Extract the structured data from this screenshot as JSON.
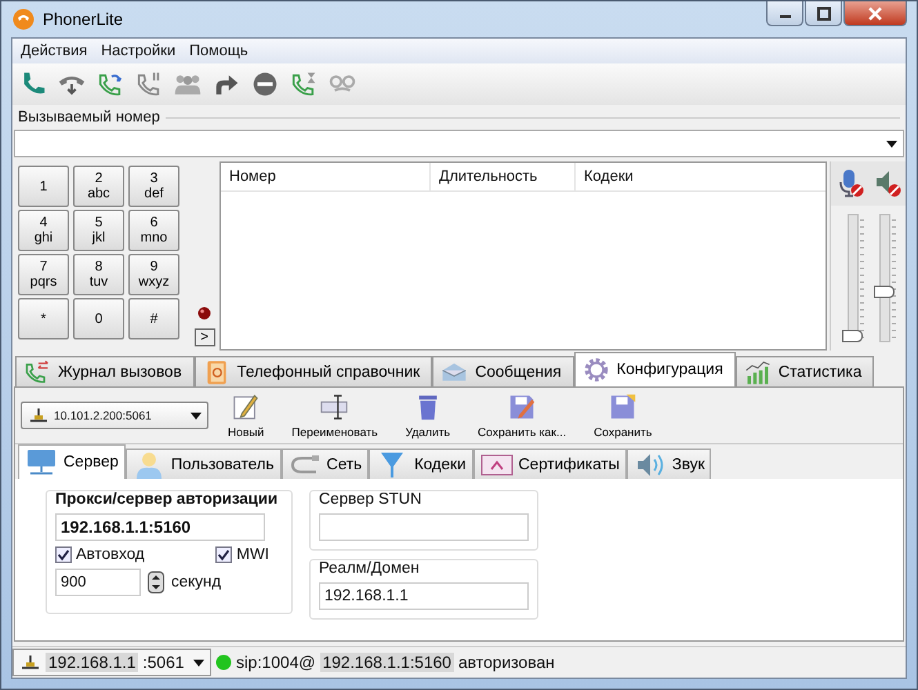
{
  "window": {
    "title": "PhonerLite"
  },
  "menu": [
    "Действия",
    "Настройки",
    "Помощь"
  ],
  "called_number": {
    "label": "Вызываемый номер"
  },
  "keypad": [
    {
      "digit": "1"
    },
    {
      "digit": "2",
      "letters": "abc"
    },
    {
      "digit": "3",
      "letters": "def"
    },
    {
      "digit": "4",
      "letters": "ghi"
    },
    {
      "digit": "5",
      "letters": "jkl"
    },
    {
      "digit": "6",
      "letters": "mno"
    },
    {
      "digit": "7",
      "letters": "pqrs"
    },
    {
      "digit": "8",
      "letters": "tuv"
    },
    {
      "digit": "9",
      "letters": "wxyz"
    },
    {
      "digit": "*"
    },
    {
      "digit": "0"
    },
    {
      "digit": "#"
    }
  ],
  "expand_button": ">",
  "call_list": {
    "columns": [
      "Номер",
      "Длительность",
      "Кодеки"
    ]
  },
  "volume": {
    "microphone": {
      "level": 0.0
    },
    "speaker": {
      "level": 0.4
    }
  },
  "main_tabs": [
    {
      "label": "Журнал вызовов",
      "selected": false
    },
    {
      "label": "Телефонный справочник",
      "selected": false
    },
    {
      "label": "Сообщения",
      "selected": false
    },
    {
      "label": "Конфигурация",
      "selected": true
    },
    {
      "label": "Статистика",
      "selected": false
    }
  ],
  "profile": {
    "value": "10.101.2.200:5061"
  },
  "config_toolbar": [
    "Новый",
    "Переименовать",
    "Удалить",
    "Сохранить как...",
    "Сохранить"
  ],
  "sub_tabs": [
    {
      "label": "Сервер",
      "selected": true
    },
    {
      "label": "Пользователь",
      "selected": false
    },
    {
      "label": "Сеть",
      "selected": false
    },
    {
      "label": "Кодеки",
      "selected": false
    },
    {
      "label": "Сертификаты",
      "selected": false
    },
    {
      "label": "Звук",
      "selected": false
    }
  ],
  "server": {
    "proxy_label": "Прокси/сервер авторизации",
    "proxy_value": "192.168.1.1:5160",
    "autologin": {
      "label": "Автовход",
      "checked": true
    },
    "mwi": {
      "label": "MWI",
      "checked": true
    },
    "interval": "900",
    "interval_unit": "секунд",
    "stun_label": "Сервер STUN",
    "realm_label": "Реалм/Домен",
    "realm_value": "192.168.1.1"
  },
  "status_bar": {
    "local_ip": "192.168.1.1",
    "local_port": ":5061",
    "sip_user": "sip:1004@",
    "sip_server": "192.168.1.1:5160",
    "state": "авторизован"
  }
}
